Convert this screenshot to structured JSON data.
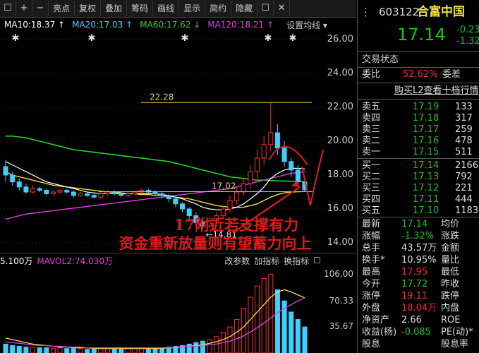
{
  "toolbar": {
    "items": [
      "☐",
      "+",
      "−",
      "亮点",
      "复权",
      "叠加",
      "筹码",
      "画线",
      "显示",
      "简约",
      "隐藏",
      "☐",
      "✕"
    ]
  },
  "ma": {
    "ma10": "MA10:18.37 ↑",
    "ma20": "MA20:17.03 ↑",
    "ma60": "MA60:17.62 ↓",
    "ma120": "MA120:18.21 ↑",
    "setting": "设置均线 ▾",
    "colors": {
      "ma10": "#ffffff",
      "ma20": "#f0e040",
      "ma60": "#30d030",
      "ma120": "#e040e0"
    }
  },
  "price_axis": [
    "26.00",
    "24.00",
    "22.00",
    "20.00",
    "18.00",
    "16.00",
    "14.00"
  ],
  "labels": {
    "high": "22.28",
    "mid": "17.02",
    "low": "←14.81"
  },
  "annotation": {
    "line1": "17附近若支撑有力",
    "line2": "资金重新放量则有望蓄力向上"
  },
  "volume_bar": {
    "vol": "5.100万",
    "mavol2": "MAVOL2:74.030万",
    "btn1": "改参数",
    "btn2": "加指标",
    "btn3": "换指标",
    "close": "☐"
  },
  "volume_axis": [
    "106.00",
    "70.33",
    "35.67"
  ],
  "chart_data": {
    "type": "candlestick",
    "y_range": [
      13.5,
      26.5
    ],
    "candles": [
      [
        18.5,
        18.0,
        18.9,
        17.6
      ],
      [
        18.0,
        17.6,
        18.2,
        17.4
      ],
      [
        17.6,
        17.3,
        17.8,
        17.1
      ],
      [
        17.3,
        17.0,
        17.5,
        16.9
      ],
      [
        17.0,
        17.2,
        17.4,
        16.9
      ],
      [
        17.2,
        17.1,
        17.3,
        17.0
      ],
      [
        17.1,
        16.9,
        17.2,
        16.8
      ],
      [
        16.9,
        17.0,
        17.1,
        16.8
      ],
      [
        17.0,
        17.1,
        17.2,
        16.9
      ],
      [
        17.1,
        17.0,
        17.2,
        16.9
      ],
      [
        17.0,
        16.8,
        17.1,
        16.7
      ],
      [
        16.8,
        16.9,
        17.0,
        16.7
      ],
      [
        16.9,
        16.8,
        17.0,
        16.7
      ],
      [
        16.8,
        16.7,
        16.9,
        16.6
      ],
      [
        16.7,
        16.9,
        17.0,
        16.6
      ],
      [
        16.9,
        17.0,
        17.1,
        16.8
      ],
      [
        17.0,
        16.9,
        17.1,
        16.8
      ],
      [
        16.9,
        16.8,
        17.0,
        16.7
      ],
      [
        16.8,
        16.9,
        17.0,
        16.7
      ],
      [
        16.9,
        17.0,
        17.1,
        16.8
      ],
      [
        17.0,
        17.1,
        17.2,
        16.9
      ],
      [
        17.1,
        17.0,
        17.2,
        16.9
      ],
      [
        17.0,
        16.9,
        17.1,
        16.8
      ],
      [
        16.9,
        16.8,
        17.0,
        16.6
      ],
      [
        16.8,
        16.6,
        16.9,
        16.4
      ],
      [
        16.6,
        16.3,
        16.7,
        16.1
      ],
      [
        16.3,
        16.0,
        16.4,
        15.8
      ],
      [
        16.0,
        15.6,
        16.1,
        15.3
      ],
      [
        15.6,
        15.2,
        15.8,
        14.9
      ],
      [
        15.2,
        15.0,
        15.4,
        14.81
      ],
      [
        15.0,
        15.3,
        15.5,
        14.9
      ],
      [
        15.3,
        15.6,
        15.8,
        15.1
      ],
      [
        15.6,
        16.0,
        16.2,
        15.4
      ],
      [
        16.0,
        16.5,
        16.8,
        15.8
      ],
      [
        16.5,
        17.0,
        17.3,
        16.3
      ],
      [
        17.0,
        17.5,
        17.8,
        16.8
      ],
      [
        17.5,
        18.2,
        18.6,
        17.2
      ],
      [
        18.2,
        19.0,
        19.5,
        17.8
      ],
      [
        19.0,
        19.8,
        20.3,
        18.6
      ],
      [
        19.8,
        20.5,
        22.28,
        19.4
      ],
      [
        20.5,
        19.6,
        21.0,
        19.2
      ],
      [
        19.6,
        18.8,
        20.0,
        18.5
      ],
      [
        18.8,
        18.3,
        19.0,
        17.9
      ],
      [
        18.3,
        17.6,
        18.6,
        17.4
      ],
      [
        17.6,
        17.14,
        17.95,
        17.0
      ]
    ],
    "ma10": [
      18.8,
      18.6,
      18.4,
      18.2,
      18.0,
      17.8,
      17.6,
      17.5,
      17.4,
      17.3,
      17.2,
      17.1,
      17.0,
      16.95,
      16.9,
      16.9,
      16.9,
      16.9,
      16.9,
      16.9,
      16.9,
      16.9,
      16.9,
      16.85,
      16.8,
      16.7,
      16.6,
      16.45,
      16.3,
      16.1,
      16.0,
      15.95,
      15.95,
      16.0,
      16.1,
      16.3,
      16.6,
      16.9,
      17.3,
      17.8,
      18.1,
      18.3,
      18.4,
      18.4,
      18.37
    ],
    "ma20": [
      18.2,
      18.0,
      17.9,
      17.8,
      17.7,
      17.6,
      17.5,
      17.4,
      17.35,
      17.3,
      17.25,
      17.2,
      17.15,
      17.1,
      17.05,
      17.0,
      17.0,
      16.95,
      16.9,
      16.9,
      16.85,
      16.85,
      16.8,
      16.8,
      16.75,
      16.7,
      16.65,
      16.6,
      16.5,
      16.4,
      16.3,
      16.2,
      16.15,
      16.1,
      16.1,
      16.1,
      16.2,
      16.3,
      16.5,
      16.7,
      16.85,
      16.95,
      17.0,
      17.02,
      17.03
    ],
    "ma60": [
      20.3,
      20.3,
      20.25,
      20.2,
      20.1,
      20.0,
      19.9,
      19.8,
      19.7,
      19.6,
      19.5,
      19.45,
      19.4,
      19.35,
      19.3,
      19.25,
      19.2,
      19.15,
      19.1,
      19.05,
      19.0,
      18.95,
      18.9,
      18.85,
      18.8,
      18.7,
      18.6,
      18.5,
      18.4,
      18.3,
      18.2,
      18.1,
      18.0,
      17.9,
      17.85,
      17.8,
      17.75,
      17.7,
      17.7,
      17.68,
      17.66,
      17.65,
      17.64,
      17.63,
      17.62
    ],
    "ma120": [
      15.4,
      15.5,
      15.6,
      15.7,
      15.75,
      15.8,
      15.85,
      15.9,
      15.95,
      16.0,
      16.05,
      16.1,
      16.15,
      16.2,
      16.25,
      16.3,
      16.35,
      16.4,
      16.45,
      16.5,
      16.55,
      16.6,
      16.65,
      16.7,
      16.75,
      16.8,
      16.85,
      16.9,
      16.95,
      17.0,
      17.05,
      17.1,
      17.15,
      17.2,
      17.3,
      17.4,
      17.5,
      17.6,
      17.7,
      17.8,
      17.9,
      18.0,
      18.1,
      18.15,
      18.21
    ],
    "volume": [
      12,
      10,
      9,
      8,
      8,
      7,
      7,
      6,
      7,
      6,
      6,
      6,
      5,
      5,
      6,
      6,
      5,
      5,
      6,
      6,
      7,
      6,
      6,
      7,
      8,
      9,
      10,
      12,
      14,
      16,
      18,
      22,
      28,
      35,
      45,
      60,
      75,
      90,
      100,
      106,
      85,
      70,
      55,
      45,
      35
    ],
    "mavol_yellow": [
      20,
      18,
      16,
      14,
      12,
      11,
      10,
      9,
      8,
      8,
      7,
      7,
      7,
      6,
      6,
      6,
      6,
      6,
      6,
      6,
      6,
      6,
      6,
      6,
      7,
      7,
      8,
      9,
      10,
      11,
      13,
      15,
      18,
      22,
      28,
      35,
      45,
      55,
      65,
      75,
      82,
      85,
      82,
      78,
      74
    ],
    "mavol_purple": [
      15,
      14,
      13,
      12,
      11,
      10,
      10,
      9,
      9,
      8,
      8,
      8,
      7,
      7,
      7,
      7,
      7,
      7,
      7,
      7,
      7,
      7,
      7,
      7,
      7,
      8,
      8,
      9,
      9,
      10,
      11,
      12,
      14,
      16,
      19,
      23,
      28,
      34,
      40,
      47,
      54,
      60,
      65,
      70,
      74
    ]
  },
  "quote": {
    "code": "603122",
    "name": "合富中国",
    "price": "17.14",
    "change": "-0.23",
    "change_pct": "-1.32",
    "status": "交易状态",
    "weibi_label": "委比",
    "weibi": "52.62%",
    "weicha_label": "委差",
    "l2_link": "购买L2查看十档行情",
    "sells": [
      [
        "卖五",
        "17.19",
        "133"
      ],
      [
        "卖四",
        "17.18",
        "317"
      ],
      [
        "卖三",
        "17.17",
        "259"
      ],
      [
        "卖二",
        "17.16",
        "478"
      ],
      [
        "卖一",
        "17.15",
        "511"
      ]
    ],
    "buys": [
      [
        "买一",
        "17.14",
        "2166"
      ],
      [
        "买二",
        "17.13",
        "792"
      ],
      [
        "买三",
        "17.12",
        "221"
      ],
      [
        "买四",
        "17.11",
        "444"
      ],
      [
        "买五",
        "17.10",
        "1183"
      ]
    ],
    "stats": [
      [
        "最新",
        "17.14",
        "均价"
      ],
      [
        "涨幅",
        "-1.32%",
        "涨跌"
      ],
      [
        "总手",
        "43.57万",
        "金额"
      ],
      [
        "换手*",
        "10.95%",
        "量比"
      ],
      [
        "最高",
        "17.95",
        "最低"
      ],
      [
        "今开",
        "17.72",
        "昨收"
      ],
      [
        "涨停",
        "19.11",
        "跌停"
      ],
      [
        "外盘",
        "18.04万",
        "内盘"
      ],
      [
        "净资产",
        "2.66",
        "ROE"
      ],
      [
        "收益(扬)",
        "-0.085",
        "PE(动)*"
      ],
      [
        "股息",
        "",
        "股息率"
      ]
    ]
  }
}
